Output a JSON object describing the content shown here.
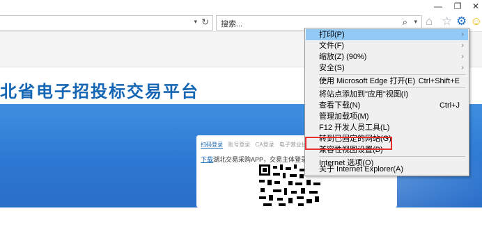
{
  "window_controls": {
    "minimize": "—",
    "maximize": "❐",
    "close": "✕"
  },
  "address_bar": {
    "dropdown": "▾",
    "refresh": "↻"
  },
  "search_box": {
    "placeholder": "搜索...",
    "search_icon": "⌕",
    "dropdown": "▾"
  },
  "toolbar": {
    "home": "⌂",
    "favorites": "☆",
    "tools": "⚙",
    "smiley": "☺"
  },
  "page": {
    "title": "北省电子招投标交易平台",
    "login": {
      "tabs": [
        "扫码登录",
        "账号登录",
        "CA登录",
        "电子营业执照"
      ],
      "download_link": "下载",
      "download_text": "湖北交易采购APP，交易主体登录后"
    }
  },
  "menu": {
    "items": [
      {
        "label": "打印(P)",
        "arrow": "›",
        "highlighted": true
      },
      {
        "label": "文件(F)",
        "arrow": "›"
      },
      {
        "label": "缩放(Z) (90%)",
        "arrow": "›"
      },
      {
        "label": "安全(S)",
        "arrow": "›"
      },
      {
        "label": "使用 Microsoft Edge 打开(E)",
        "shortcut": "Ctrl+Shift+E"
      },
      {
        "label": "将站点添加到\"应用\"视图(I)"
      },
      {
        "label": "查看下载(N)",
        "shortcut": "Ctrl+J"
      },
      {
        "label": "管理加载项(M)"
      },
      {
        "label": "F12 开发人员工具(L)"
      },
      {
        "label": "转到已固定的网站(G)"
      },
      {
        "label": "兼容性视图设置(B)",
        "emphasized": true
      },
      {
        "label": "Internet 选项(O)"
      },
      {
        "label": "关于 Internet Explorer(A)"
      }
    ]
  },
  "colors": {
    "menu_highlight": "#91c9f7",
    "emphasis_box": "#e8302e",
    "brand_blue": "#1565b5"
  }
}
